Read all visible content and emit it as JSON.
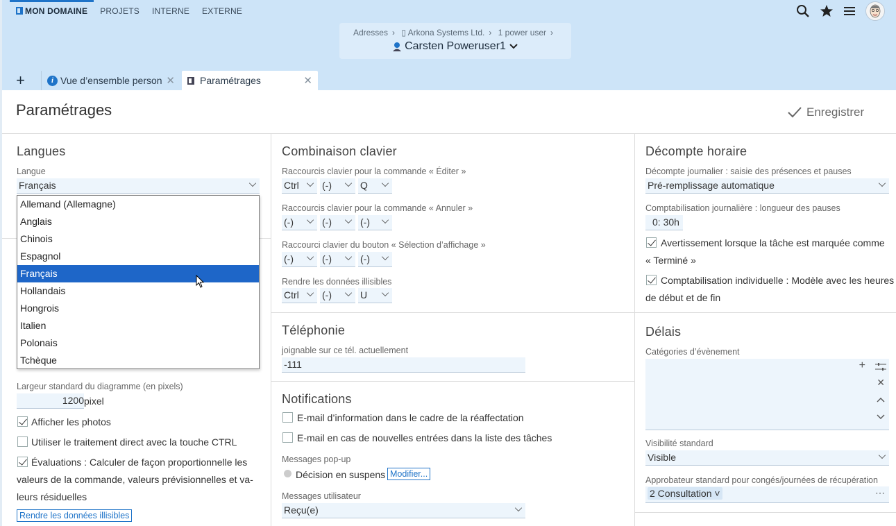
{
  "nav": {
    "items": [
      "MON DOMAINE",
      "PROJETS",
      "INTERNE",
      "EXTERNE"
    ]
  },
  "breadcrumb": {
    "items": [
      "Adresses",
      "Arkona Systems Ltd.",
      "1 power user"
    ],
    "title": "Carsten Poweruser1"
  },
  "tabs": {
    "add": "+",
    "tab1": "Vue d’ensemble person",
    "tab2": "Paramétrages"
  },
  "page": {
    "title": "Paramétrages",
    "save": "Enregistrer"
  },
  "langues": {
    "heading": "Langues",
    "langue_label": "Langue",
    "langue_value": "Français",
    "options": [
      "Allemand (Allemagne)",
      "Anglais",
      "Chinois",
      "Espagnol",
      "Français",
      "Hollandais",
      "Hongrois",
      "Italien",
      "Polonais",
      "Tchèque"
    ],
    "largeur_label": "Largeur standard du diagramme (en pixels)",
    "largeur_value": "1200",
    "largeur_unit": "pixel",
    "photos": "Afficher les photos",
    "ctrl": "Utiliser le traitement direct avec la touche CTRL",
    "eval1": "Évaluations : Calculer de façon proportionnelle les",
    "eval2": "valeurs de la commande, valeurs prévisionnelles et va-",
    "eval3": "leurs résiduelles",
    "illisible_btn": "Rendre les données illisibles"
  },
  "clavier": {
    "heading": "Combinaison clavier",
    "editer_label": "Raccourcis clavier pour la commande « Éditer »",
    "editer": [
      "Ctrl",
      "(-)",
      "Q"
    ],
    "annuler_label": "Raccourcis clavier pour la commande « Annuler »",
    "annuler": [
      "(-)",
      "(-)",
      "(-)"
    ],
    "selection_label": "Raccourci clavier du bouton « Sélection d’affichage »",
    "selection": [
      "(-)",
      "(-)",
      "(-)"
    ],
    "illisible_label": "Rendre les données illisibles",
    "illisible": [
      "Ctrl",
      "(-)",
      "U"
    ]
  },
  "telephonie": {
    "heading": "Téléphonie",
    "label": "joignable sur ce tél. actuellement",
    "value": "-111"
  },
  "notifications": {
    "heading": "Notifications",
    "email1": "E-mail d’information dans le cadre de la réaffectation",
    "email2": "E-mail en cas de nouvelles entrées dans la liste des tâches",
    "popup_label": "Messages pop-up",
    "popup_item": "Décision en suspens",
    "modifier": "Modifier...",
    "user_label": "Messages utilisateur",
    "user_value": "Reçu(e)"
  },
  "decompte": {
    "heading": "Décompte horaire",
    "journalier_label": "Décompte journalier : saisie des présences et pauses",
    "journalier_value": "Pré-remplissage automatique",
    "pauses_label": "Comptabilisation journalière : longueur des pauses",
    "pauses_h": "0",
    "pauses_m": "30",
    "pauses_unit": "h",
    "avert1": "Avertissement lorsque la tâche est marquée comme",
    "avert2": "« Terminé »",
    "indiv1": "Comptabilisation individuelle : Modèle avec les heures",
    "indiv2": "de début et de fin"
  },
  "delais": {
    "heading": "Délais",
    "categories_label": "Catégories d’évènement",
    "visibilite_label": "Visibilité standard",
    "visibilite_value": "Visible",
    "approb_label": "Approbateur standard pour congés/journées de récupération",
    "approb_value": "2 Consultation"
  }
}
